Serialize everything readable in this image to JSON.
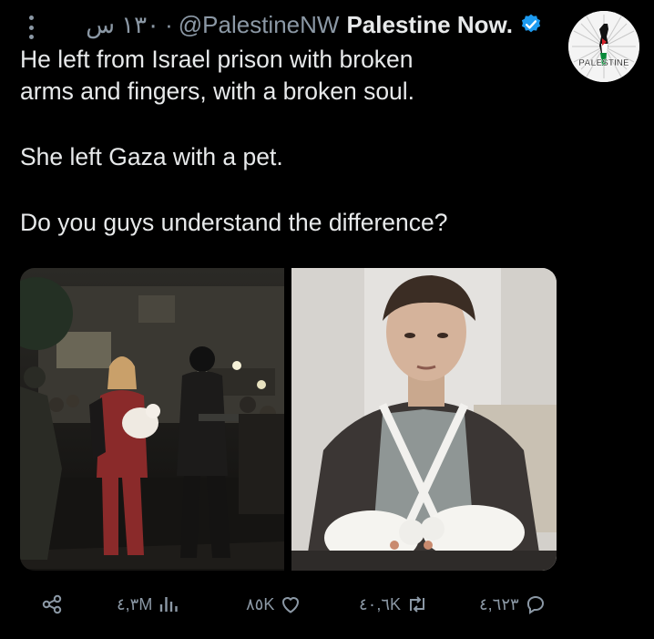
{
  "tweet": {
    "timestamp": "١٣٠ س",
    "separator": "·",
    "handle": "@PalestineNW",
    "display_name": "Palestine Now.",
    "avatar_text": "PALESTINE",
    "body": [
      "He left from Israel prison with broken",
      "arms and fingers, with a broken soul.",
      "She left Gaza with a pet.",
      "Do you guys understand the difference?"
    ]
  },
  "actions": {
    "views": "٤,٣M",
    "likes": "٨٥K",
    "retweets": "٤٠,٦K",
    "replies": "٤,٦٢٣"
  },
  "colors": {
    "background": "#000000",
    "text": "#e7e9ea",
    "muted": "#8b98a5",
    "verified": "#1d9bf0"
  }
}
